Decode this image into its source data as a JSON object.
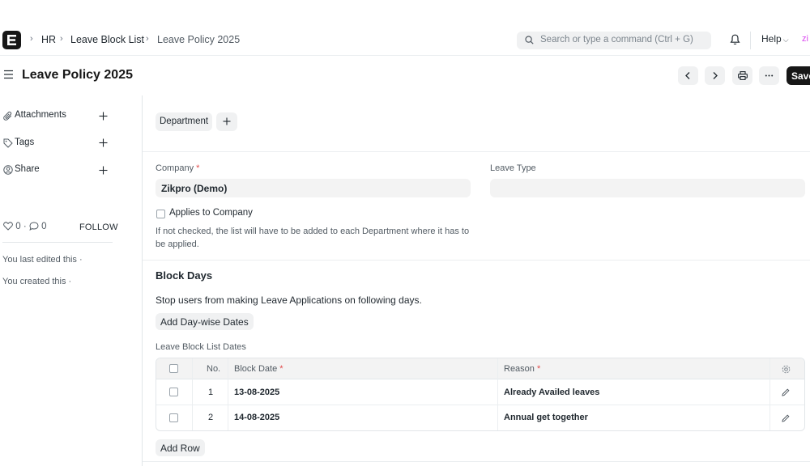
{
  "navbar": {
    "breadcrumbs": [
      "HR",
      "Leave Block List",
      "Leave Policy 2025"
    ],
    "search_placeholder": "Search or type a command (Ctrl + G)",
    "help_label": "Help",
    "avatar_text": "zi"
  },
  "page": {
    "title": "Leave Policy 2025",
    "save_label": "Save"
  },
  "sidebar": {
    "items": [
      {
        "label": "Attachments",
        "icon": "paperclip-icon"
      },
      {
        "label": "Tags",
        "icon": "tag-icon"
      },
      {
        "label": "Share",
        "icon": "share-user-icon"
      }
    ],
    "likes": "0",
    "comments": "0",
    "follow_label": "FOLLOW",
    "last_edited": "You last edited this ·",
    "created": "You created this ·"
  },
  "form": {
    "department_button": "Department",
    "company": {
      "label": "Company",
      "value": "Zikpro (Demo)"
    },
    "leave_type": {
      "label": "Leave Type",
      "value": ""
    },
    "applies_to_company": {
      "label": "Applies to Company",
      "checked": false
    },
    "help_text": "If not checked, the list will have to be added to each Department where it has to be applied.",
    "block_days": {
      "title": "Block Days",
      "description": "Stop users from making Leave Applications on following days.",
      "daywise_button": "Add Day-wise Dates",
      "table_label": "Leave Block List Dates",
      "columns": {
        "no": "No.",
        "block_date": "Block Date",
        "reason": "Reason"
      },
      "rows": [
        {
          "no": "1",
          "block_date": "13-08-2025",
          "reason": "Already Availed leaves"
        },
        {
          "no": "2",
          "block_date": "14-08-2025",
          "reason": "Annual get together"
        }
      ],
      "add_row_button": "Add Row"
    }
  },
  "colors": {
    "accent": "#171717",
    "required": "#e24c4c",
    "control_bg": "#f0f1f2"
  }
}
